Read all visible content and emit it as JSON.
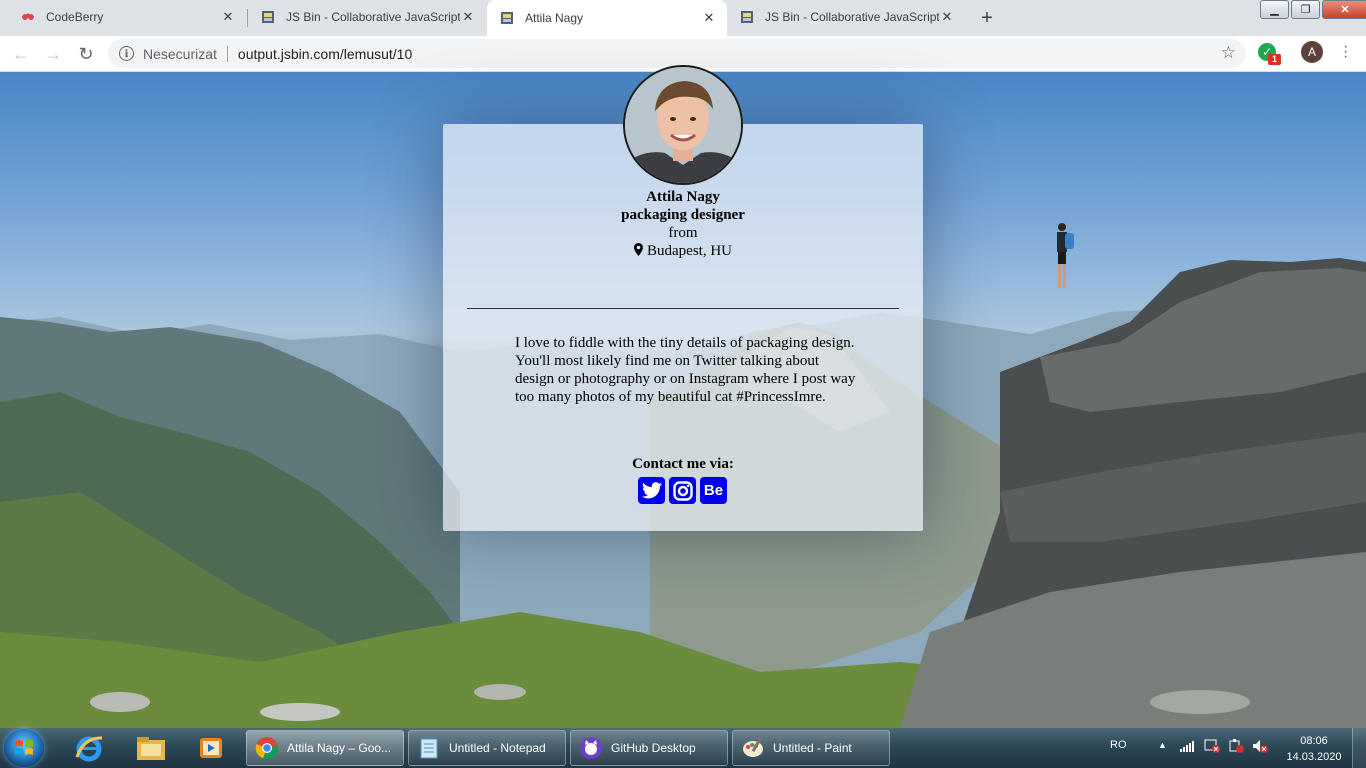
{
  "browser": {
    "tabs": [
      {
        "title": "CodeBerry",
        "active": false
      },
      {
        "title": "JS Bin - Collaborative JavaScript D",
        "active": false
      },
      {
        "title": "Attila Nagy",
        "active": true
      },
      {
        "title": "JS Bin - Collaborative JavaScript D",
        "active": false
      }
    ],
    "security_label": "Nesecurizat",
    "url": "output.jsbin.com/lemusut/10",
    "extension_badge": "1",
    "profile_initial": "A"
  },
  "profile": {
    "name": "Attila Nagy",
    "role": "packaging designer",
    "from_label": "from",
    "location": "Budapest, HU",
    "bio": "I love to fiddle with the tiny details of packaging design. You'll most likely find me on Twitter talking about design or photography or on Instagram where I post way too many photos of my beautiful cat #PrincessImre.",
    "contact_label": "Contact me via:",
    "socials": [
      {
        "name": "twitter-icon"
      },
      {
        "name": "instagram-icon"
      },
      {
        "name": "behance-icon",
        "text": "Be"
      }
    ]
  },
  "taskbar": {
    "tasks": [
      {
        "label": "Attila Nagy – Goo...",
        "active": true
      },
      {
        "label": "Untitled - Notepad",
        "active": false
      },
      {
        "label": "GitHub Desktop",
        "active": false
      },
      {
        "label": "Untitled - Paint",
        "active": false
      }
    ],
    "language": "RO",
    "time": "08:06",
    "date": "14.03.2020"
  },
  "colors": {
    "link_blue": "#0000ee",
    "tab_strip": "#dee1e6"
  }
}
